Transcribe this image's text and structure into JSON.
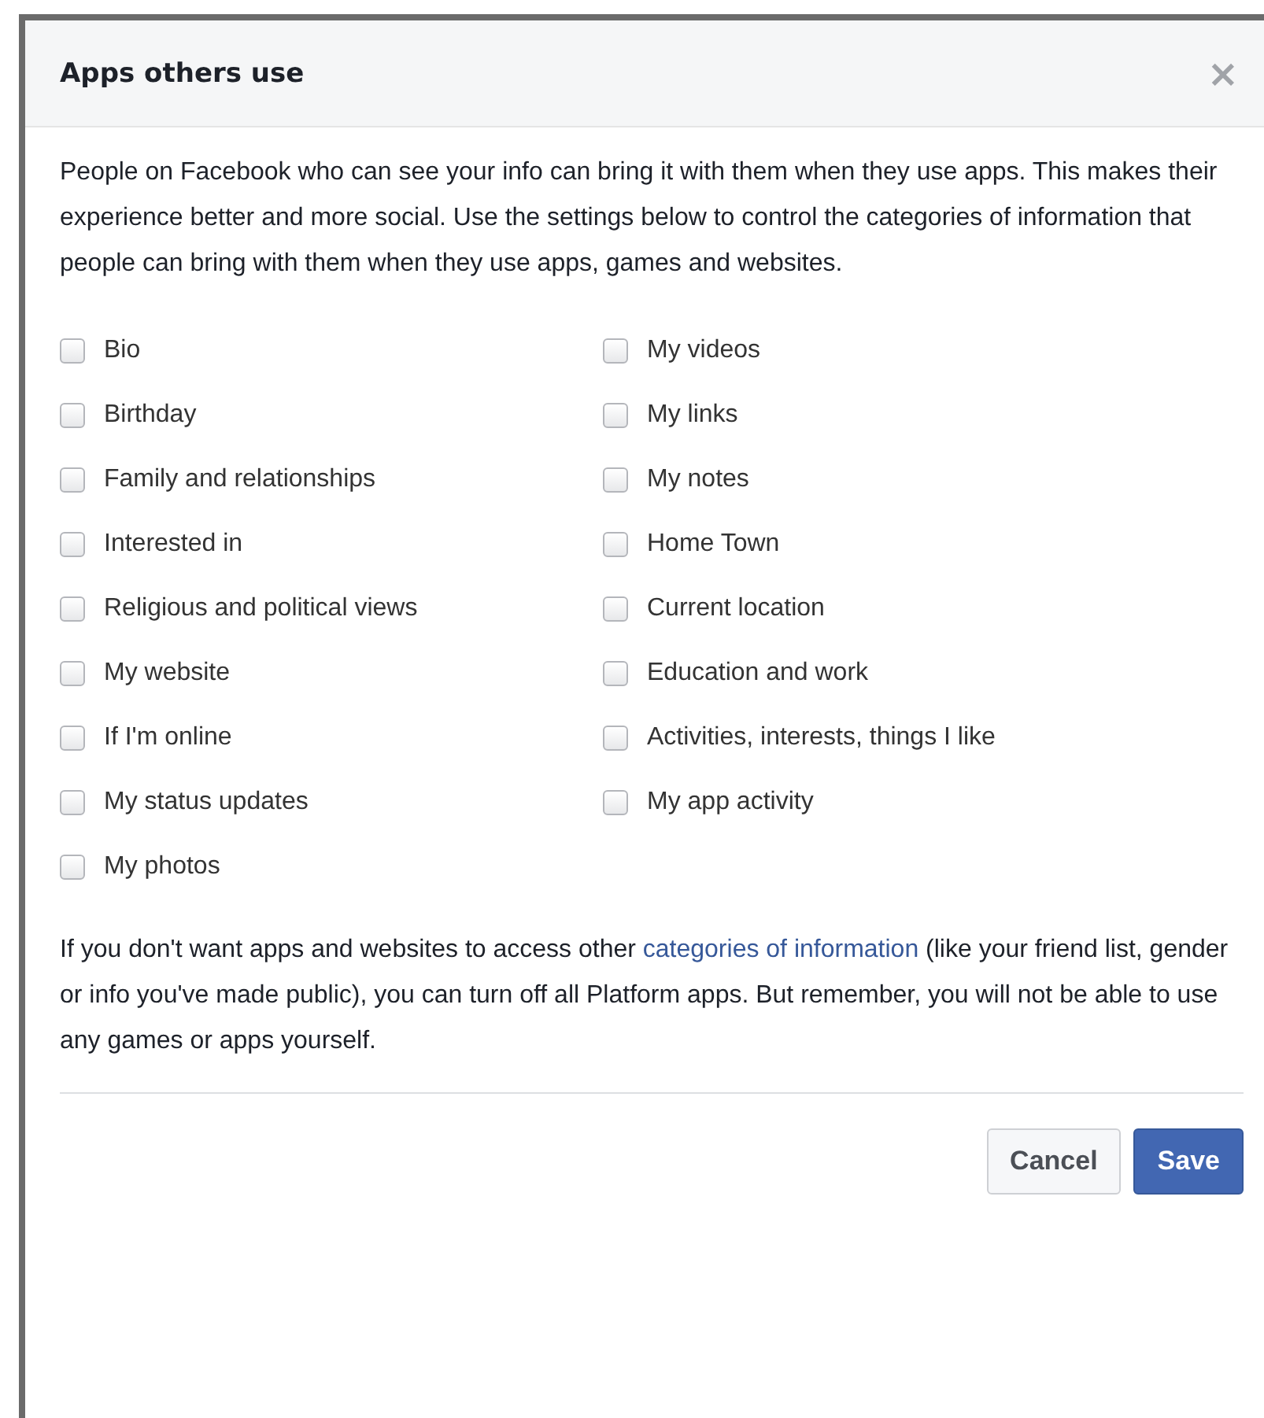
{
  "dialog": {
    "title": "Apps others use",
    "close": "×",
    "intro": "People on Facebook who can see your info can bring it with them when they use apps. This makes their experience better and more social. Use the settings below to control the categories of information that people can bring with them when they use apps, games and websites.",
    "columns": [
      [
        {
          "label": "Bio",
          "checked": false
        },
        {
          "label": "Birthday",
          "checked": false
        },
        {
          "label": "Family and relationships",
          "checked": false
        },
        {
          "label": "Interested in",
          "checked": false
        },
        {
          "label": "Religious and political views",
          "checked": false
        },
        {
          "label": "My website",
          "checked": false
        },
        {
          "label": "If I'm online",
          "checked": false
        },
        {
          "label": "My status updates",
          "checked": false
        },
        {
          "label": "My photos",
          "checked": false
        }
      ],
      [
        {
          "label": "My videos",
          "checked": false
        },
        {
          "label": "My links",
          "checked": false
        },
        {
          "label": "My notes",
          "checked": false
        },
        {
          "label": "Home Town",
          "checked": false
        },
        {
          "label": "Current location",
          "checked": false
        },
        {
          "label": "Education and work",
          "checked": false
        },
        {
          "label": "Activities, interests, things I like",
          "checked": false
        },
        {
          "label": "My app activity",
          "checked": false
        }
      ]
    ],
    "footer_text_before": "If you don't want apps and websites to access other",
    "footer_link": "categories of information",
    "footer_text_after": "(like your friend list, gender or info you've made public), you can turn off all Platform apps. But remember, you will not be able to use any games or apps yourself.",
    "buttons": [
      {
        "label": "Cancel",
        "kind": "secondary"
      },
      {
        "label": "Save",
        "kind": "primary"
      }
    ]
  }
}
